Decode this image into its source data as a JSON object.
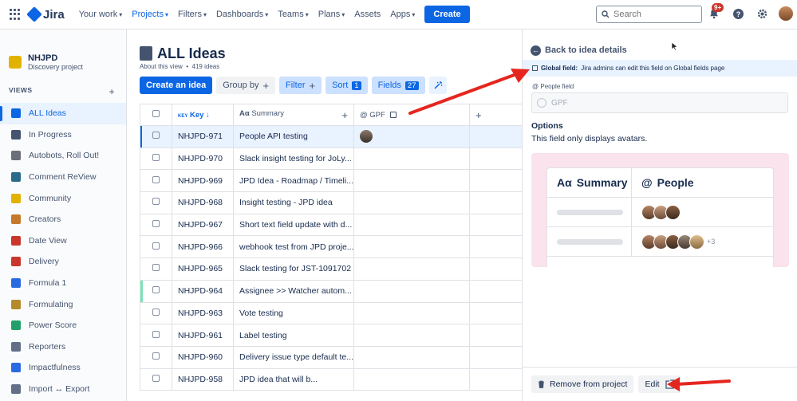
{
  "nav": {
    "logo": "Jira",
    "items": [
      {
        "label": "Your work"
      },
      {
        "label": "Projects",
        "active": true
      },
      {
        "label": "Filters"
      },
      {
        "label": "Dashboards"
      },
      {
        "label": "Teams"
      },
      {
        "label": "Plans"
      },
      {
        "label": "Assets",
        "nochev": true
      },
      {
        "label": "Apps"
      }
    ],
    "create": "Create",
    "search_placeholder": "Search",
    "notifications_badge": "9+"
  },
  "sidebar": {
    "project_name": "NHJPD",
    "project_type": "Discovery project",
    "views_header": "VIEWS",
    "views": [
      {
        "label": "ALL Ideas",
        "icon": "list-icon",
        "color": "#0c66e4",
        "active": true
      },
      {
        "label": "In Progress",
        "icon": "timeline-icon",
        "color": "#44546f"
      },
      {
        "label": "Autobots, Roll Out!",
        "icon": "robot-icon",
        "color": "#6a6f78"
      },
      {
        "label": "Comment ReView",
        "icon": "speech-icon",
        "color": "#2a6a8a"
      },
      {
        "label": "Community",
        "icon": "handshake-icon",
        "color": "#e2b203"
      },
      {
        "label": "Creators",
        "icon": "person-icon",
        "color": "#c47a2a"
      },
      {
        "label": "Date View",
        "icon": "calendar-icon",
        "color": "#c9372c"
      },
      {
        "label": "Delivery",
        "icon": "truck-icon",
        "color": "#c9372c"
      },
      {
        "label": "Formula 1",
        "icon": "racecar-icon",
        "color": "#2a6ae0"
      },
      {
        "label": "Formulating",
        "icon": "lab-icon",
        "color": "#b58a2a"
      },
      {
        "label": "Power Score",
        "icon": "battery-icon",
        "color": "#22a06b"
      },
      {
        "label": "Reporters",
        "icon": "pen-icon",
        "color": "#626f86"
      },
      {
        "label": "Impactfulness",
        "icon": "chart-icon",
        "color": "#2a6ae0"
      },
      {
        "label": "Import ↔ Export",
        "icon": "import-export-icon",
        "color": "#626f86"
      }
    ]
  },
  "main": {
    "title": "ALL Ideas",
    "about": "About this view",
    "idea_count": "419 ideas",
    "toolbar": {
      "create": "Create an idea",
      "group_by": "Group by",
      "filter": "Filter",
      "sort": "Sort",
      "sort_count": "1",
      "fields": "Fields",
      "fields_count": "27"
    },
    "columns": {
      "key": "Key",
      "summary": "Summary",
      "gpf": "GPF"
    },
    "rows": [
      {
        "key": "NHJPD-971",
        "summary": "People API testing",
        "avatar": true,
        "selected": true
      },
      {
        "key": "NHJPD-970",
        "summary": "Slack insight testing for JoLy..."
      },
      {
        "key": "NHJPD-969",
        "summary": "JPD Idea - Roadmap / Timeli..."
      },
      {
        "key": "NHJPD-968",
        "summary": "Insight testing - JPD idea"
      },
      {
        "key": "NHJPD-967",
        "summary": "Short text field update with d..."
      },
      {
        "key": "NHJPD-966",
        "summary": "webhook test from JPD proje..."
      },
      {
        "key": "NHJPD-965",
        "summary": "Slack testing for JST-1091702"
      },
      {
        "key": "NHJPD-964",
        "summary": "Assignee >> Watcher autom...",
        "green": true
      },
      {
        "key": "NHJPD-963",
        "summary": "Vote testing"
      },
      {
        "key": "NHJPD-961",
        "summary": "Label testing"
      },
      {
        "key": "NHJPD-960",
        "summary": "Delivery issue type default te..."
      },
      {
        "key": "NHJPD-958",
        "summary": "JPD idea that will b..."
      }
    ]
  },
  "panel": {
    "back": "Back to idea details",
    "global_prefix": "Global field:",
    "global_text": "Jira admins can edit this field on Global fields page",
    "field_type": "People field",
    "field_name": "GPF",
    "options_title": "Options",
    "options_desc": "This field only displays avatars.",
    "preview_summary": "Summary",
    "preview_people": "People",
    "preview_more": "+3",
    "remove": "Remove from project",
    "edit": "Edit"
  }
}
